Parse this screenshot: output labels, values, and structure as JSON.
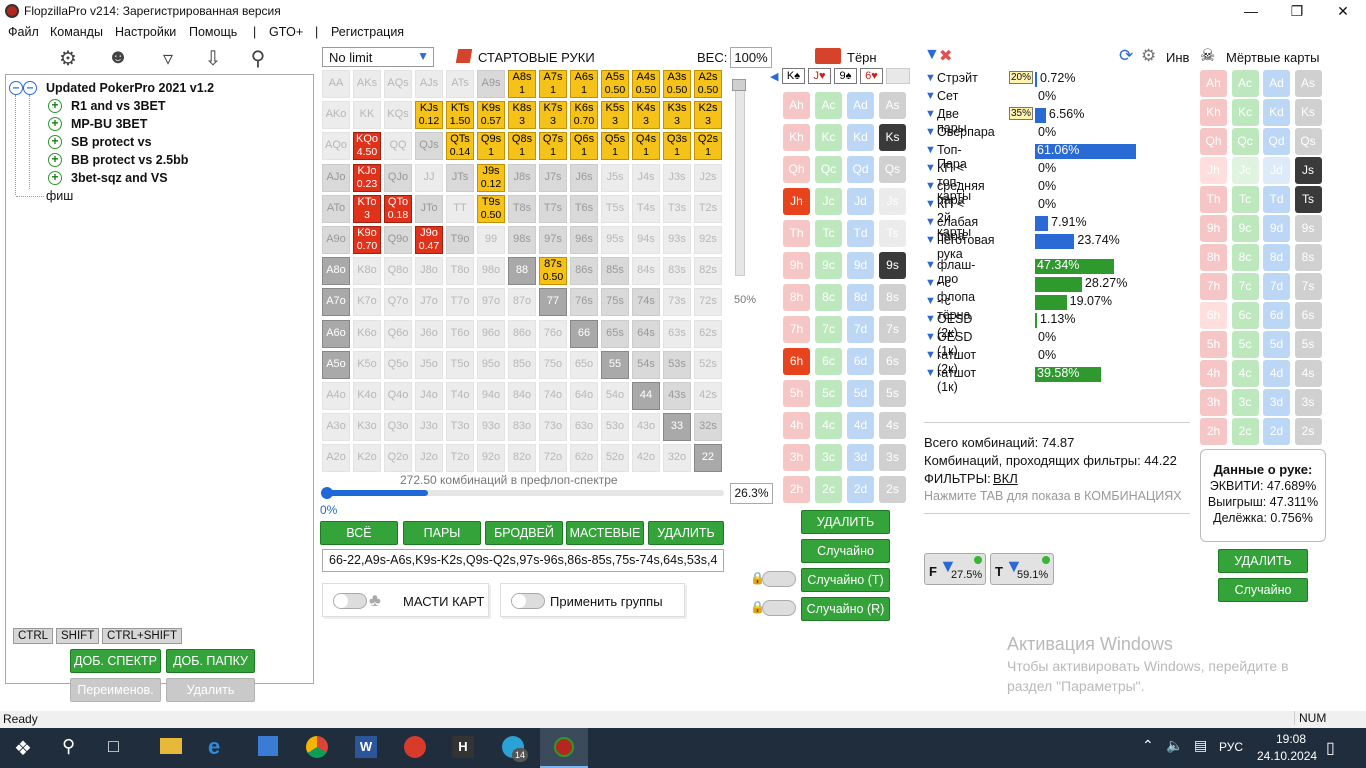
{
  "window": {
    "title": "FlopzillaPro v214: Зарегистрированная версия"
  },
  "menu": [
    "Файл",
    "Команды",
    "Настройки",
    "Помощь",
    "|",
    "GTO+",
    "|",
    "Регистрация"
  ],
  "tree": {
    "root": "Updated PokerPro 2021 v1.2",
    "children": [
      "R1 and vs 3BET",
      "MP-BU 3BET",
      "SB protect vs",
      "BB protect vs 2.5bb",
      "3bet-sqz and VS"
    ],
    "other": "фиш"
  },
  "left_tabs": [
    "CTRL",
    "SHIFT",
    "CTRL+SHIFT"
  ],
  "left_buttons": {
    "add_range": "ДОБ. СПЕКТР",
    "add_folder": "ДОБ. ПАПКУ",
    "rename": "Переименов.",
    "delete": "Удалить"
  },
  "range_panel": {
    "game_type": "No limit",
    "starting_hands": "СТАРТОВЫЕ РУКИ",
    "weight_label": "ВЕС:",
    "weight_value": "100%",
    "slider_pct": "50%",
    "combos_label": "272.50 комбинаций в префлоп-спектре",
    "progress_left": "0%",
    "progress_value": "26.3%",
    "progress_fraction": 0.263,
    "buttons": [
      "ВСЁ",
      "ПАРЫ",
      "БРОДВЕЙ",
      "МАСТЕВЫЕ",
      "УДАЛИТЬ"
    ],
    "range_text": "66-22,A9s-A6s,K9s-K2s,Q9s-Q2s,97s-96s,86s-85s,75s-74s,64s,53s,4",
    "suits_label": "МАСТИ КАРТ",
    "groups_label": "Применить группы"
  },
  "matrix": [
    [
      [
        "AA",
        "e"
      ],
      [
        "AKs",
        "e"
      ],
      [
        "AQs",
        "e"
      ],
      [
        "AJs",
        "e"
      ],
      [
        "ATs",
        "e"
      ],
      [
        "A9s",
        "g"
      ],
      [
        "A8s",
        "y",
        "1"
      ],
      [
        "A7s",
        "y",
        "1"
      ],
      [
        "A6s",
        "y",
        "1"
      ],
      [
        "A5s",
        "y",
        "0.50"
      ],
      [
        "A4s",
        "y",
        "0.50"
      ],
      [
        "A3s",
        "y",
        "0.50"
      ],
      [
        "A2s",
        "y",
        "0.50"
      ]
    ],
    [
      [
        "AKo",
        "e"
      ],
      [
        "KK",
        "e"
      ],
      [
        "KQs",
        "e"
      ],
      [
        "KJs",
        "y",
        "0.12"
      ],
      [
        "KTs",
        "y",
        "1.50"
      ],
      [
        "K9s",
        "y",
        "0.57"
      ],
      [
        "K8s",
        "y",
        "3"
      ],
      [
        "K7s",
        "y",
        "3"
      ],
      [
        "K6s",
        "y",
        "0.70"
      ],
      [
        "K5s",
        "y",
        "3"
      ],
      [
        "K4s",
        "y",
        "3"
      ],
      [
        "K3s",
        "y",
        "3"
      ],
      [
        "K2s",
        "y",
        "3"
      ]
    ],
    [
      [
        "AQo",
        "e"
      ],
      [
        "KQo",
        "r",
        "4.50"
      ],
      [
        "QQ",
        "e"
      ],
      [
        "QJs",
        "g"
      ],
      [
        "QTs",
        "y",
        "0.14"
      ],
      [
        "Q9s",
        "y",
        "1"
      ],
      [
        "Q8s",
        "y",
        "1"
      ],
      [
        "Q7s",
        "y",
        "1"
      ],
      [
        "Q6s",
        "y",
        "1"
      ],
      [
        "Q5s",
        "y",
        "1"
      ],
      [
        "Q4s",
        "y",
        "1"
      ],
      [
        "Q3s",
        "y",
        "1"
      ],
      [
        "Q2s",
        "y",
        "1"
      ]
    ],
    [
      [
        "AJo",
        "g"
      ],
      [
        "KJo",
        "r",
        "0.23"
      ],
      [
        "QJo",
        "g"
      ],
      [
        "JJ",
        "e"
      ],
      [
        "JTs",
        "g"
      ],
      [
        "J9s",
        "y",
        "0.12"
      ],
      [
        "J8s",
        "g"
      ],
      [
        "J7s",
        "g"
      ],
      [
        "J6s",
        "g"
      ],
      [
        "J5s",
        "e"
      ],
      [
        "J4s",
        "e"
      ],
      [
        "J3s",
        "e"
      ],
      [
        "J2s",
        "e"
      ]
    ],
    [
      [
        "ATo",
        "g"
      ],
      [
        "KTo",
        "r",
        "3"
      ],
      [
        "QTo",
        "r",
        "0.18"
      ],
      [
        "JTo",
        "g"
      ],
      [
        "TT",
        "e"
      ],
      [
        "T9s",
        "y",
        "0.50"
      ],
      [
        "T8s",
        "g"
      ],
      [
        "T7s",
        "g"
      ],
      [
        "T6s",
        "g"
      ],
      [
        "T5s",
        "e"
      ],
      [
        "T4s",
        "e"
      ],
      [
        "T3s",
        "e"
      ],
      [
        "T2s",
        "e"
      ]
    ],
    [
      [
        "A9o",
        "g"
      ],
      [
        "K9o",
        "r",
        "0.70"
      ],
      [
        "Q9o",
        "g"
      ],
      [
        "J9o",
        "r",
        "0.47"
      ],
      [
        "T9o",
        "g"
      ],
      [
        "99",
        "e"
      ],
      [
        "98s",
        "g"
      ],
      [
        "97s",
        "g"
      ],
      [
        "96s",
        "g"
      ],
      [
        "95s",
        "e"
      ],
      [
        "94s",
        "e"
      ],
      [
        "93s",
        "e"
      ],
      [
        "92s",
        "e"
      ]
    ],
    [
      [
        "A8o",
        "dg"
      ],
      [
        "K8o",
        "e"
      ],
      [
        "Q8o",
        "e"
      ],
      [
        "J8o",
        "e"
      ],
      [
        "T8o",
        "e"
      ],
      [
        "98o",
        "e"
      ],
      [
        "88",
        "dg"
      ],
      [
        "87s",
        "y",
        "0.50"
      ],
      [
        "86s",
        "g"
      ],
      [
        "85s",
        "g"
      ],
      [
        "84s",
        "e"
      ],
      [
        "83s",
        "e"
      ],
      [
        "82s",
        "e"
      ]
    ],
    [
      [
        "A7o",
        "dg"
      ],
      [
        "K7o",
        "e"
      ],
      [
        "Q7o",
        "e"
      ],
      [
        "J7o",
        "e"
      ],
      [
        "T7o",
        "e"
      ],
      [
        "97o",
        "e"
      ],
      [
        "87o",
        "e"
      ],
      [
        "77",
        "dg"
      ],
      [
        "76s",
        "g"
      ],
      [
        "75s",
        "g"
      ],
      [
        "74s",
        "g"
      ],
      [
        "73s",
        "e"
      ],
      [
        "72s",
        "e"
      ]
    ],
    [
      [
        "A6o",
        "dg"
      ],
      [
        "K6o",
        "e"
      ],
      [
        "Q6o",
        "e"
      ],
      [
        "J6o",
        "e"
      ],
      [
        "T6o",
        "e"
      ],
      [
        "96o",
        "e"
      ],
      [
        "86o",
        "e"
      ],
      [
        "76o",
        "e"
      ],
      [
        "66",
        "dg"
      ],
      [
        "65s",
        "g"
      ],
      [
        "64s",
        "g"
      ],
      [
        "63s",
        "e"
      ],
      [
        "62s",
        "e"
      ]
    ],
    [
      [
        "A5o",
        "dg"
      ],
      [
        "K5o",
        "e"
      ],
      [
        "Q5o",
        "e"
      ],
      [
        "J5o",
        "e"
      ],
      [
        "T5o",
        "e"
      ],
      [
        "95o",
        "e"
      ],
      [
        "85o",
        "e"
      ],
      [
        "75o",
        "e"
      ],
      [
        "65o",
        "e"
      ],
      [
        "55",
        "dg"
      ],
      [
        "54s",
        "g"
      ],
      [
        "53s",
        "g"
      ],
      [
        "52s",
        "e"
      ]
    ],
    [
      [
        "A4o",
        "e"
      ],
      [
        "K4o",
        "e"
      ],
      [
        "Q4o",
        "e"
      ],
      [
        "J4o",
        "e"
      ],
      [
        "T4o",
        "e"
      ],
      [
        "94o",
        "e"
      ],
      [
        "84o",
        "e"
      ],
      [
        "74o",
        "e"
      ],
      [
        "64o",
        "e"
      ],
      [
        "54o",
        "e"
      ],
      [
        "44",
        "dg"
      ],
      [
        "43s",
        "g"
      ],
      [
        "42s",
        "e"
      ]
    ],
    [
      [
        "A3o",
        "e"
      ],
      [
        "K3o",
        "e"
      ],
      [
        "Q3o",
        "e"
      ],
      [
        "J3o",
        "e"
      ],
      [
        "T3o",
        "e"
      ],
      [
        "93o",
        "e"
      ],
      [
        "83o",
        "e"
      ],
      [
        "73o",
        "e"
      ],
      [
        "63o",
        "e"
      ],
      [
        "53o",
        "e"
      ],
      [
        "43o",
        "e"
      ],
      [
        "33",
        "dg"
      ],
      [
        "32s",
        "g"
      ]
    ],
    [
      [
        "A2o",
        "e"
      ],
      [
        "K2o",
        "e"
      ],
      [
        "Q2o",
        "e"
      ],
      [
        "J2o",
        "e"
      ],
      [
        "T2o",
        "e"
      ],
      [
        "92o",
        "e"
      ],
      [
        "82o",
        "e"
      ],
      [
        "72o",
        "e"
      ],
      [
        "62o",
        "e"
      ],
      [
        "52o",
        "e"
      ],
      [
        "42o",
        "e"
      ],
      [
        "32o",
        "e"
      ],
      [
        "22",
        "dg"
      ]
    ]
  ],
  "turn": {
    "title": "Тёрн",
    "board": [
      "K♠",
      "J♥",
      "9♠",
      "6♥"
    ],
    "ranks": [
      "A",
      "K",
      "Q",
      "J",
      "T",
      "9",
      "8",
      "7",
      "6",
      "5",
      "4",
      "3",
      "2"
    ],
    "suits": [
      "h",
      "c",
      "d",
      "s"
    ],
    "buttons": {
      "delete": "УДАЛИТЬ",
      "random": "Случайно",
      "random_t": "Случайно (T)",
      "random_r": "Случайно (R)"
    }
  },
  "stats": {
    "inv_label": "Инв",
    "rows": [
      {
        "label": "Стрэйт",
        "value": "0.72%",
        "badge": "20%",
        "pct": 0.72,
        "color": "#2a6ad4"
      },
      {
        "label": "Сет",
        "value": "0%",
        "pct": 0,
        "color": "#2a6ad4"
      },
      {
        "label": "Две пары",
        "value": "6.56%",
        "badge": "35%",
        "pct": 6.56,
        "color": "#2a6ad4"
      },
      {
        "label": "Оверпара",
        "value": "0%",
        "pct": 0,
        "color": "#2a6ad4"
      },
      {
        "label": "Топ-Пара",
        "value": "61.06%",
        "pct": 61.06,
        "color": "#2a6ad4",
        "inbar": true
      },
      {
        "label": "КП < топ-карты",
        "value": "0%",
        "pct": 0,
        "color": "#2a6ad4"
      },
      {
        "label": "средняя пара",
        "value": "0%",
        "pct": 0,
        "color": "#2a6ad4"
      },
      {
        "label": "КП < 2й карты",
        "value": "0%",
        "pct": 0,
        "color": "#2a6ad4"
      },
      {
        "label": "слабая пара",
        "value": "7.91%",
        "pct": 7.91,
        "color": "#2a6ad4"
      },
      {
        "label": "неготовая рука",
        "value": "23.74%",
        "pct": 23.74,
        "color": "#2a6ad4"
      },
      {
        "label": "флаш-дро",
        "value": "47.34%",
        "pct": 47.34,
        "color": "#2e9a2e",
        "inbar": true
      },
      {
        "label": "- с флопа",
        "value": "28.27%",
        "pct": 28.27,
        "color": "#2e9a2e"
      },
      {
        "label": "- с тёрна",
        "value": "19.07%",
        "pct": 19.07,
        "color": "#2e9a2e"
      },
      {
        "label": "OESD (2к)",
        "value": "1.13%",
        "pct": 1.13,
        "color": "#2e9a2e"
      },
      {
        "label": "OESD (1к)",
        "value": "0%",
        "pct": 0,
        "color": "#2e9a2e"
      },
      {
        "label": "гатшот (2к)",
        "value": "0%",
        "pct": 0,
        "color": "#2e9a2e"
      },
      {
        "label": "гатшот (1к)",
        "value": "39.58%",
        "pct": 39.58,
        "color": "#2e9a2e",
        "inbar": true
      }
    ],
    "total_combos": "Всего комбинаций: 74.87",
    "filtered_combos": "Комбинаций, проходящих фильтры: 44.22",
    "filters_label": "ФИЛЬТРЫ:",
    "filters_value": "ВКЛ",
    "tab_hint": "Нажмите TAB для показа в КОМБИНАЦИЯХ",
    "f_badge": "27.5%",
    "t_badge": "59.1%"
  },
  "dead": {
    "title": "Мёртвые карты",
    "hand_title": "Данные о руке:",
    "equity": "ЭКВИТИ: 47.689%",
    "win": "Выигрыш: 47.311%",
    "tie": "Делёжка: 0.756%",
    "delete": "УДАЛИТЬ",
    "random": "Случайно"
  },
  "watermark": {
    "line1": "Активация Windows",
    "line2": "Чтобы активировать Windows, перейдите в",
    "line3": "раздел \"Параметры\"."
  },
  "status": {
    "left": "Ready",
    "right": "NUM"
  },
  "taskbar": {
    "lang": "РУС",
    "time": "19:08",
    "date": "24.10.2024",
    "badge": "14"
  }
}
